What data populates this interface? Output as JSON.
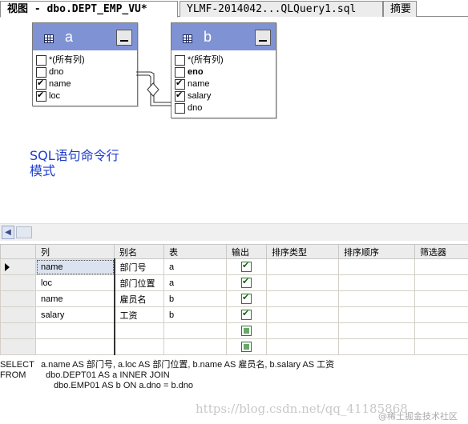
{
  "tabs": [
    {
      "label": "视图 - dbo.DEPT_EMP_VU*",
      "active": true
    },
    {
      "label": "YLMF-2014042...QLQuery1.sql",
      "active": false
    },
    {
      "label": "摘要",
      "active": false
    }
  ],
  "diagram": {
    "tables": [
      {
        "name": "a",
        "columns": [
          {
            "label": "*(所有列)",
            "checked": false,
            "bold": false
          },
          {
            "label": "dno",
            "checked": false,
            "bold": false
          },
          {
            "label": "name",
            "checked": true,
            "bold": false
          },
          {
            "label": "loc",
            "checked": true,
            "bold": false
          }
        ]
      },
      {
        "name": "b",
        "columns": [
          {
            "label": "*(所有列)",
            "checked": false,
            "bold": false
          },
          {
            "label": "eno",
            "checked": false,
            "bold": true
          },
          {
            "label": "name",
            "checked": true,
            "bold": false
          },
          {
            "label": "salary",
            "checked": true,
            "bold": false
          },
          {
            "label": "dno",
            "checked": false,
            "bold": false
          }
        ]
      }
    ],
    "sql_pane_label_1": "SQL语句命令行",
    "sql_pane_label_2": "模式"
  },
  "grid": {
    "headers": [
      "列",
      "别名",
      "表",
      "输出",
      "排序类型",
      "排序顺序",
      "筛选器"
    ],
    "rows": [
      {
        "column": "name",
        "alias": "部门号",
        "table": "a",
        "output": true,
        "current": true
      },
      {
        "column": "loc",
        "alias": "部门位置",
        "table": "a",
        "output": true,
        "current": false
      },
      {
        "column": "name",
        "alias": "雇员名",
        "table": "b",
        "output": true,
        "current": false
      },
      {
        "column": "salary",
        "alias": "工资",
        "table": "b",
        "output": true,
        "current": false
      },
      {
        "column": "",
        "alias": "",
        "table": "",
        "output": false,
        "current": false
      },
      {
        "column": "",
        "alias": "",
        "table": "",
        "output": false,
        "current": false
      }
    ]
  },
  "sql": {
    "select_kw": "SELECT",
    "select_text": "a.name AS 部门号, a.loc AS 部门位置, b.name AS 雇员名, b.salary AS 工资",
    "from_kw": "FROM",
    "from_text": "dbo.DEPT01 AS a INNER JOIN",
    "join_text": "dbo.EMP01 AS b ON a.dno = b.dno"
  },
  "watermark": {
    "url": "https://blog.csdn.net/qq_41185868",
    "badge": "@稀土掘金技术社区"
  },
  "colors": {
    "table_title": "#7f93d4",
    "sql_pane_label": "#1e3ccc"
  }
}
